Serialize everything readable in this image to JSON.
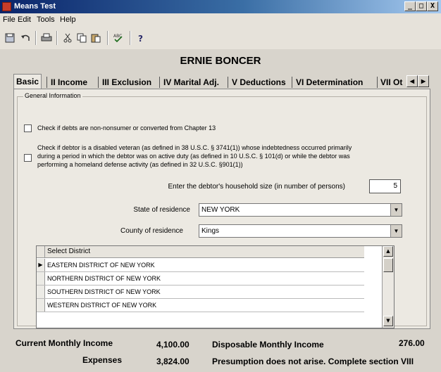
{
  "window": {
    "title": "Means Test",
    "min_label": "_",
    "max_label": "□",
    "close_label": "X"
  },
  "menu": [
    "File",
    "Edit",
    "Tools",
    "Help"
  ],
  "toolbar_icons": [
    "save-icon",
    "undo-icon",
    "print-icon",
    "cut-icon",
    "copy-icon",
    "paste-icon",
    "spellcheck-icon",
    "help-icon"
  ],
  "debtor_name": "ERNIE BONCER",
  "tabs": [
    "Basic",
    "II Income",
    "III Exclusion",
    "IV Marital Adj.",
    "V Deductions",
    "VI Determination",
    "VII Ot"
  ],
  "group_title": "General Information",
  "checkbox1_label": "Check if debts are non-nonsumer or converted from Chapter 13",
  "checkbox2_lines": [
    "Check if debtor is a disabled veteran (as defined in 38 U.S.C. § 3741(1)) whose indebtedness occurred primarily",
    "during a period in which the debtor was on active duty (as defined in 10 U.S.C. § 101(d) or while the debtor was",
    "performing a homeland defense activity (as defined in 32 U.S.C. §901(1))"
  ],
  "household": {
    "label": "Enter the debtor's household size (in number of persons)",
    "value": "5"
  },
  "state": {
    "label": "State of residence",
    "value": "NEW YORK"
  },
  "county": {
    "label": "County of residence",
    "value": "Kings"
  },
  "district_grid": {
    "header": "Select District",
    "rows": [
      "EASTERN DISTRICT OF NEW YORK",
      "NORTHERN DISTRICT OF NEW YORK",
      "SOUTHERN DISTRICT OF NEW YORK",
      "WESTERN DISTRICT OF NEW YORK"
    ]
  },
  "summary": {
    "cmi_label": "Current Monthly Income",
    "cmi_value": "4,100.00",
    "dmi_label": "Disposable Monthly Income",
    "dmi_value": "276.00",
    "expenses_label": "Expenses",
    "expenses_value": "3,824.00",
    "presumption": "Presumption does not arise. Complete section VIII"
  }
}
